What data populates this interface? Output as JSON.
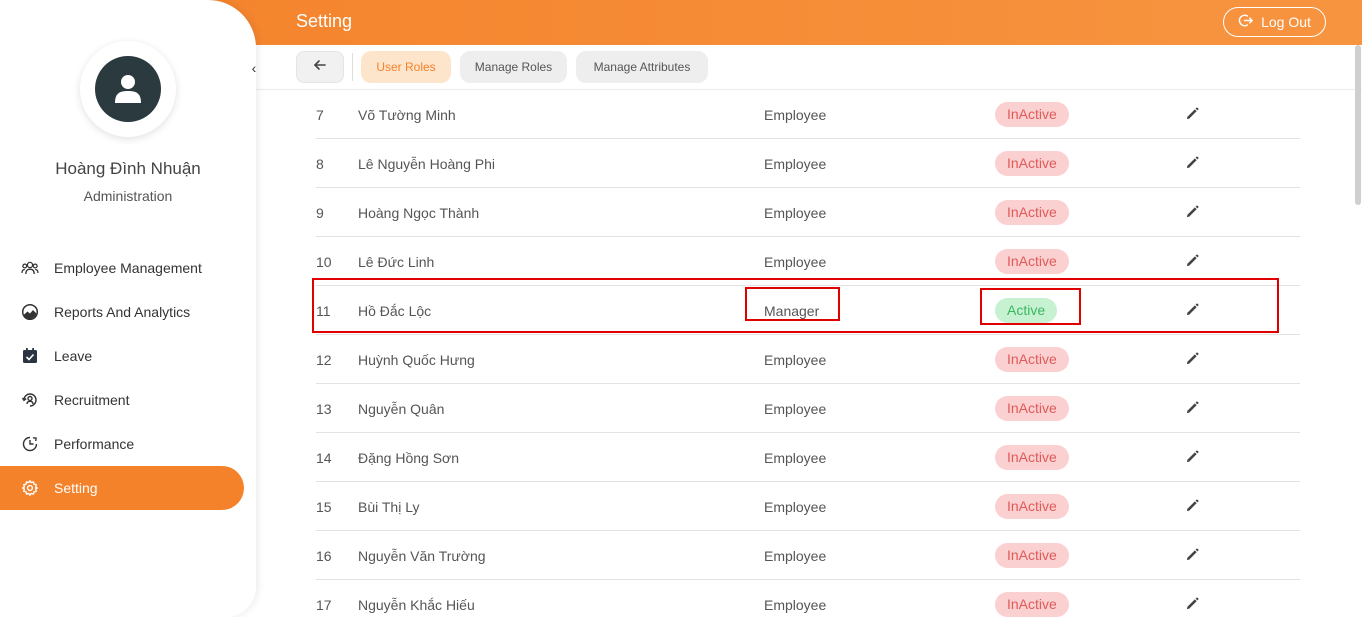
{
  "header": {
    "title": "Setting",
    "logout_label": "Log Out",
    "logout_icon": "logout-icon",
    "color": "#f4822a"
  },
  "sidebar": {
    "collapse_icon": "chevron-left-icon",
    "collapse_glyph": "‹",
    "avatar_icon": "user-icon",
    "user_name": "Hoàng Đình Nhuận",
    "user_role": "Administration",
    "items": [
      {
        "label": "Employee Management",
        "icon": "users-icon",
        "active": false
      },
      {
        "label": "Reports And Analytics",
        "icon": "chart-pie-icon",
        "active": false
      },
      {
        "label": "Leave",
        "icon": "calendar-check-icon",
        "active": false
      },
      {
        "label": "Recruitment",
        "icon": "recruitment-icon",
        "active": false
      },
      {
        "label": "Performance",
        "icon": "performance-icon",
        "active": false
      },
      {
        "label": "Setting",
        "icon": "gear-icon",
        "active": true
      }
    ],
    "active_color": "#f4822a"
  },
  "toolbar": {
    "back_icon": "arrow-left-icon",
    "tabs": [
      {
        "label": "User Roles",
        "active": true
      },
      {
        "label": "Manage Roles",
        "active": false
      },
      {
        "label": "Manage Attributes",
        "active": false
      }
    ]
  },
  "table": {
    "rows": [
      {
        "no": "7",
        "name": "Võ Tường Minh",
        "role": "Employee",
        "status": "InActive"
      },
      {
        "no": "8",
        "name": "Lê Nguyễn Hoàng Phi",
        "role": "Employee",
        "status": "InActive"
      },
      {
        "no": "9",
        "name": "Hoàng Ngọc Thành",
        "role": "Employee",
        "status": "InActive"
      },
      {
        "no": "10",
        "name": "Lê Đức Linh",
        "role": "Employee",
        "status": "InActive"
      },
      {
        "no": "11",
        "name": "Hồ Đắc Lộc",
        "role": "Manager",
        "status": "Active"
      },
      {
        "no": "12",
        "name": "Huỳnh Quốc Hưng",
        "role": "Employee",
        "status": "InActive"
      },
      {
        "no": "13",
        "name": "Nguyễn Quân",
        "role": "Employee",
        "status": "InActive"
      },
      {
        "no": "14",
        "name": "Đặng Hồng Sơn",
        "role": "Employee",
        "status": "InActive"
      },
      {
        "no": "15",
        "name": "Bùi Thị Ly",
        "role": "Employee",
        "status": "InActive"
      },
      {
        "no": "16",
        "name": "Nguyễn Văn Trường",
        "role": "Employee",
        "status": "InActive"
      },
      {
        "no": "17",
        "name": "Nguyễn Khắc Hiếu",
        "role": "Employee",
        "status": "InActive"
      }
    ],
    "edit_icon": "pencil-icon",
    "status_colors": {
      "active": "#3ab660",
      "inactive": "#e05a5a"
    },
    "highlight_color": "#e00000"
  }
}
